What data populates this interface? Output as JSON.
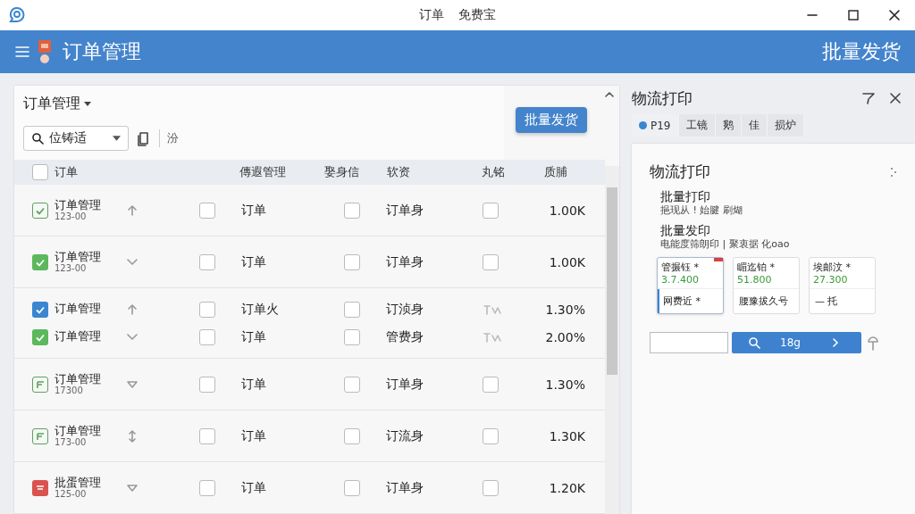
{
  "window": {
    "title_parts": [
      "订单",
      "免费宝"
    ]
  },
  "header": {
    "title": "订单管理",
    "action": "批量发货"
  },
  "orders": {
    "title": "订单管理",
    "filter": {
      "value": "位铸适"
    },
    "toolbar_text": "汾",
    "tooltip": "批量发货",
    "select_all": {
      "checked": false
    },
    "columns": [
      "订单",
      "傳遐管理",
      "娶身信",
      "软资",
      "丸铭",
      "质脯"
    ],
    "rows": [
      {
        "kind": "check-outline",
        "name": "订单管理",
        "sub": "123-00",
        "arrow": {
          "kind": "up"
        },
        "col_1": "订单",
        "col_2": "订单身",
        "marks": [
          {
            "kind": "checkbox",
            "checked": false
          },
          {
            "kind": "checkbox",
            "checked": false
          },
          {
            "kind": "checkbox",
            "checked": false
          }
        ],
        "value": "1.00K",
        "compact": false
      },
      {
        "kind": "check-green",
        "name": "订单管理",
        "sub": "123-00",
        "arrow": {
          "kind": "down"
        },
        "col_1": "订单",
        "col_2": "订单身",
        "marks": [
          {
            "kind": "checkbox",
            "checked": false
          },
          {
            "kind": "checkbox",
            "checked": false
          },
          {
            "kind": "checkbox",
            "checked": false
          }
        ],
        "value": "1.00K",
        "compact": false
      },
      {
        "kind": "check-blue",
        "name": "订单管理",
        "arrow": {
          "kind": "up"
        },
        "col_1": "订单火",
        "col_2": "订浈身",
        "marks": [
          {
            "kind": "checkbox",
            "checked": false
          },
          {
            "kind": "checkbox",
            "checked": false
          },
          {
            "kind": "glyph"
          }
        ],
        "value": "1.30%",
        "compact": true
      },
      {
        "kind": "check-green",
        "name": "订单管理",
        "arrow": {
          "kind": "down"
        },
        "col_1": "订单",
        "col_2": "管费身",
        "marks": [
          {
            "kind": "checkbox",
            "checked": false
          },
          {
            "kind": "checkbox",
            "checked": false
          },
          {
            "kind": "glyph"
          }
        ],
        "value": "2.00%",
        "compact": true
      },
      {
        "kind": "doc",
        "name": "订单管理",
        "sub": "17300",
        "arrow": {
          "kind": "tri"
        },
        "col_1": "订单",
        "col_2": "订单身",
        "marks": [
          {
            "kind": "checkbox",
            "checked": false
          },
          {
            "kind": "checkbox",
            "checked": false
          },
          {
            "kind": "checkbox",
            "checked": false
          }
        ],
        "value": "1.30%",
        "compact": false
      },
      {
        "kind": "doc",
        "name": "订单管理",
        "sub": "173-00",
        "arrow": {
          "kind": "updown"
        },
        "col_1": "订单",
        "col_2": "订流身",
        "marks": [
          {
            "kind": "checkbox",
            "checked": false
          },
          {
            "kind": "checkbox",
            "checked": false
          },
          {
            "kind": "checkbox",
            "checked": false
          }
        ],
        "value": "1.30K",
        "compact": false
      },
      {
        "kind": "doc-red",
        "name": "批蛋管理",
        "sub": "125-00",
        "arrow": {
          "kind": "tri"
        },
        "col_1": "订单",
        "col_2": "订单身",
        "marks": [
          {
            "kind": "checkbox",
            "checked": false
          },
          {
            "kind": "checkbox",
            "checked": false
          },
          {
            "kind": "checkbox",
            "checked": false
          }
        ],
        "value": "1.20K",
        "compact": false
      }
    ]
  },
  "side": {
    "title": "物流打印",
    "tabs": [
      {
        "label": "P19",
        "selected": true
      },
      {
        "label": "工镜",
        "selected": false
      },
      {
        "label": "鹅",
        "selected": false
      },
      {
        "label": "佳",
        "selected": false
      },
      {
        "label": "损炉",
        "selected": false
      }
    ],
    "card": {
      "title": "物流打印",
      "items": [
        {
          "title": "批量打印",
          "desc": "挹现从 ! 始腱 刷煳"
        },
        {
          "title": "批量发印",
          "desc": "电能度筛朗印 | 聚衷据 化oao"
        }
      ],
      "stats": [
        {
          "label": "管搌钰 *",
          "value": "3.7.400",
          "footer": "网费近 *",
          "selected": true
        },
        {
          "label": "睸迄铂 *",
          "value": "51.800",
          "footer": "腰豫拔久号",
          "selected": false
        },
        {
          "label": "埃邮汶 *",
          "value": "27.300",
          "footer": "— 托",
          "selected": false
        }
      ],
      "button": "18g"
    }
  }
}
